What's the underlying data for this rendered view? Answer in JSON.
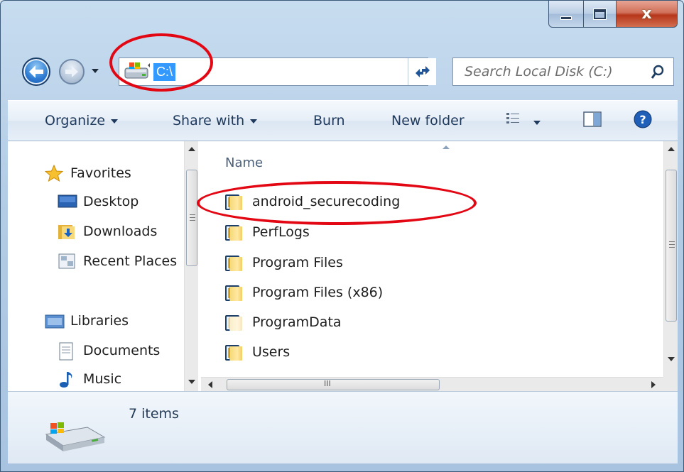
{
  "window": {
    "minimize_label": "—",
    "maximize_label": "□",
    "close_label": "x"
  },
  "address_bar": {
    "path": "C:\\"
  },
  "search": {
    "placeholder": "Search Local Disk (C:)"
  },
  "toolbar": {
    "organize": "Organize",
    "share_with": "Share with",
    "burn": "Burn",
    "new_folder": "New folder"
  },
  "nav_pane": {
    "favorites": "Favorites",
    "items": [
      "Desktop",
      "Downloads",
      "Recent Places"
    ],
    "libraries": "Libraries",
    "library_items": [
      "Documents",
      "Music"
    ]
  },
  "file_list": {
    "column_name": "Name",
    "items": [
      "android_securecoding",
      "PerfLogs",
      "Program Files",
      "Program Files (x86)",
      "ProgramData",
      "Users"
    ],
    "hscroll_grip": "III"
  },
  "details": {
    "item_count": "7 items"
  },
  "colors": {
    "annotation": "#e30613",
    "selection": "#3399ff"
  }
}
